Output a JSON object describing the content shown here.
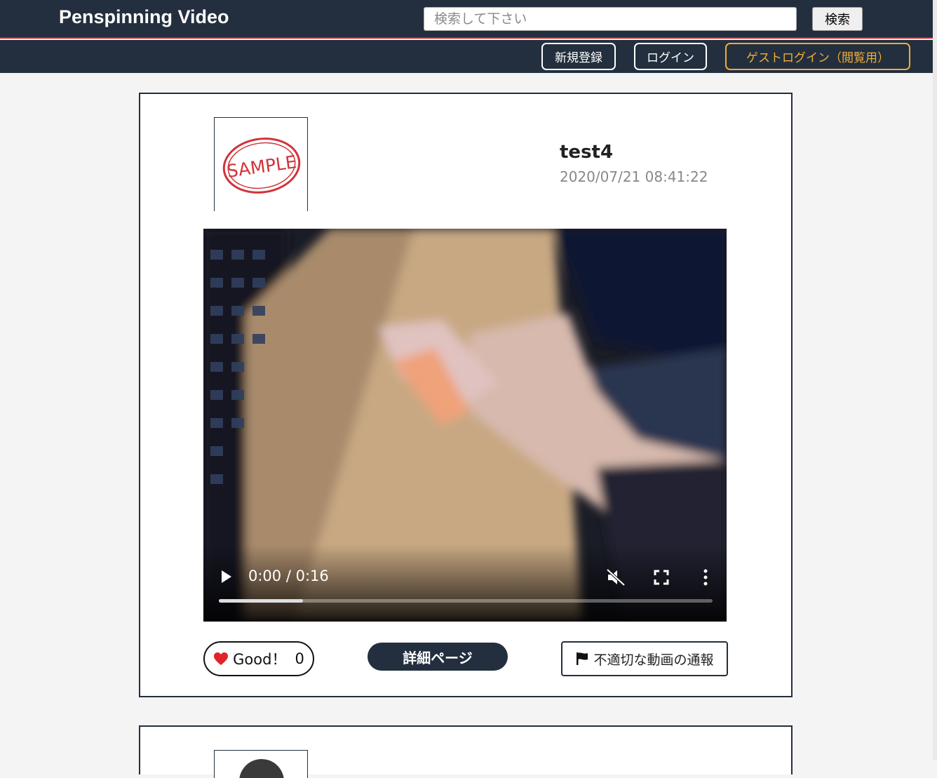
{
  "header": {
    "brand": "Penspinning Video",
    "search_placeholder": "検索して下さい",
    "search_button": "検索"
  },
  "nav": {
    "signup": "新規登録",
    "login": "ログイン",
    "guest_login": "ゲストログイン（閲覧用）"
  },
  "posts": [
    {
      "thumbnail_text": "SAMPLE",
      "username": "test4",
      "timestamp": "2020/07/21 08:41:22",
      "video": {
        "time": "0:00 / 0:16",
        "progress": 0.17
      },
      "good_label": "Good！",
      "good_count": "0",
      "detail_button": "詳細ページ",
      "report_button": "不適切な動画の通報"
    }
  ],
  "colors": {
    "navbar": "#232f3e",
    "accent_line": "#d81e1e",
    "guest": "#f0ad36",
    "heart": "#e0242a"
  }
}
